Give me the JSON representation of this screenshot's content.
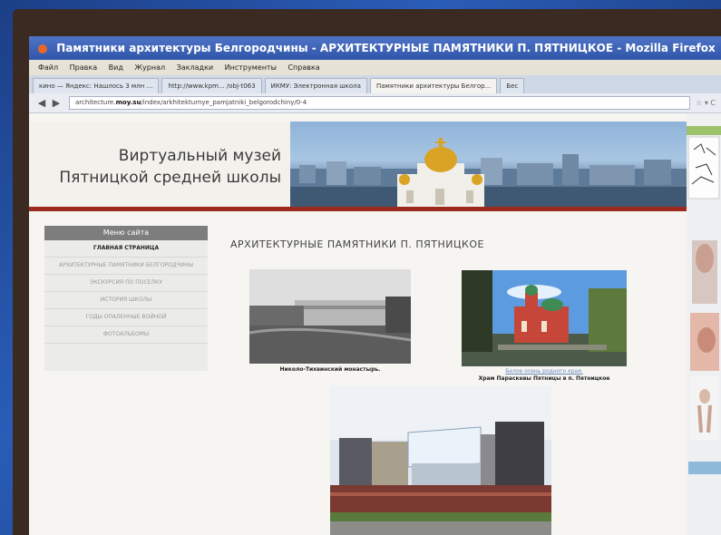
{
  "window": {
    "title": "Памятники архитектуры Белгородчины - АРХИТЕКТУРНЫЕ ПАМЯТНИКИ П. ПЯТНИЦКОЕ - Mozilla Firefox"
  },
  "menu": [
    "Файл",
    "Правка",
    "Вид",
    "Журнал",
    "Закладки",
    "Инструменты",
    "Справка"
  ],
  "tabs": [
    {
      "label": "кино — Яндекс: Нашлось 3 млн …"
    },
    {
      "label": "http://www.kpm... /obj-t063"
    },
    {
      "label": "ИКМУ: Электронная школа"
    },
    {
      "label": "Памятники архитектуры Белгор..."
    },
    {
      "label": "Бес"
    }
  ],
  "address": {
    "prefix": "architecture.",
    "domain": "moy.su",
    "path": "/index/arkhitekturnye_pamjatniki_belgorodchiny/0-4"
  },
  "site": {
    "title_line1": "Виртуальный музей",
    "title_line2": "Пятницкой средней школы"
  },
  "sidebar": {
    "header": "Меню сайта",
    "items": [
      {
        "label": "ГЛАВНАЯ СТРАНИЦА"
      },
      {
        "label": "АРХИТЕКТУРНЫЕ ПАМЯТНИКИ БЕЛГОРОДЧИНЫ"
      },
      {
        "label": "ЭКСКУРСИЯ ПО ПОСЕЛКУ"
      },
      {
        "label": "ИСТОРИЯ ШКОЛЫ"
      },
      {
        "label": "ГОДЫ ОПАЛЕННЫЕ ВОЙНОЙ"
      },
      {
        "label": "ФОТОАЛЬБОМЫ"
      }
    ]
  },
  "main": {
    "heading": "АРХИТЕКТУРНЫЕ ПАМЯТНИКИ П. ПЯТНИЦКОЕ",
    "photos": [
      {
        "caption": "Николо-Тихвинский монастырь."
      },
      {
        "link": "Белое осень родного края.",
        "caption": "Храм Параскевы Пятницы в п. Пятницкое"
      }
    ]
  },
  "colors": {
    "accent_red": "#9c2a1e",
    "menu_header": "#7d7d7d",
    "titlebar": "#2f55a8"
  }
}
